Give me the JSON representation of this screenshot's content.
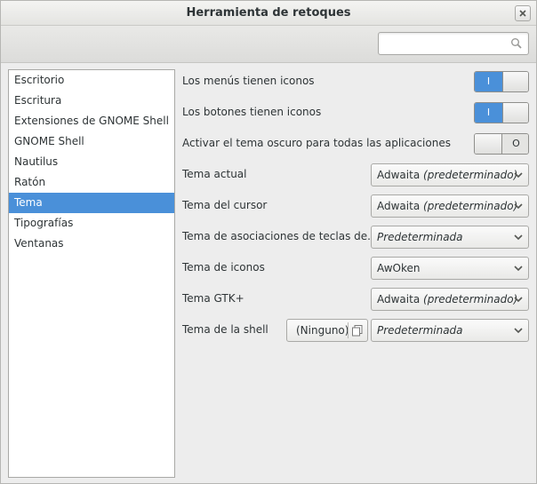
{
  "window": {
    "title": "Herramienta de retoques"
  },
  "search": {
    "value": "",
    "placeholder": "",
    "icon": "search-icon"
  },
  "sidebar": {
    "items": [
      {
        "label": "Escritorio"
      },
      {
        "label": "Escritura"
      },
      {
        "label": "Extensiones de GNOME Shell"
      },
      {
        "label": "GNOME Shell"
      },
      {
        "label": "Nautilus"
      },
      {
        "label": "Ratón"
      },
      {
        "label": "Tema",
        "selected": true
      },
      {
        "label": "Tipografías"
      },
      {
        "label": "Ventanas"
      }
    ]
  },
  "settings": {
    "menus_icons": {
      "label": "Los menús tienen iconos",
      "state": "on"
    },
    "buttons_icons": {
      "label": "Los botones tienen iconos",
      "state": "on"
    },
    "dark_theme": {
      "label": "Activar el tema oscuro para todas las aplicaciones",
      "state": "off"
    },
    "current_theme": {
      "label": "Tema actual",
      "value": "Adwaita",
      "value_note": "(predeterminado)"
    },
    "cursor_theme": {
      "label": "Tema del cursor",
      "value": "Adwaita",
      "value_note": "(predeterminado)"
    },
    "keybinding_theme": {
      "label": "Tema de asociaciones de teclas de...",
      "value": "Predeterminada"
    },
    "icon_theme": {
      "label": "Tema de iconos",
      "value": "AwOken"
    },
    "gtk_theme": {
      "label": "Tema GTK+",
      "value": "Adwaita",
      "value_note": "(predeterminado)"
    },
    "shell_theme": {
      "label": "Tema de la shell",
      "file_button": "(Ninguno)",
      "value": "Predeterminada"
    }
  },
  "switch_glyphs": {
    "on": "I",
    "off": "O"
  },
  "colors": {
    "accent": "#4a90d9",
    "selection_text": "#ffffff"
  }
}
